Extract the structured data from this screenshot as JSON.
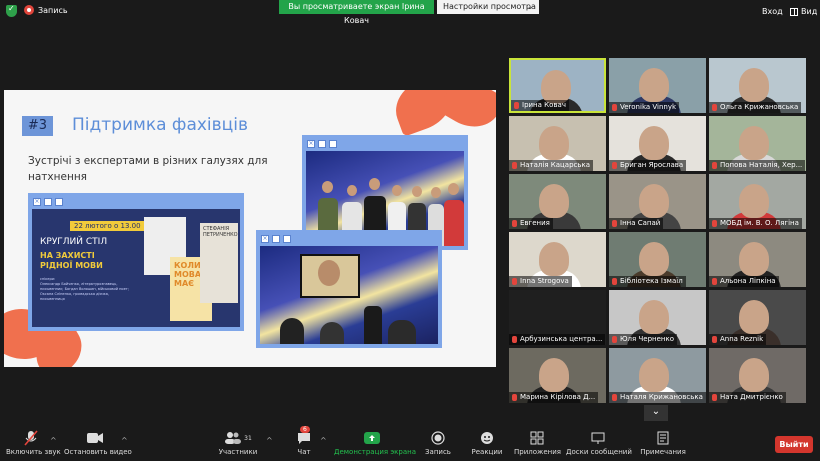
{
  "top": {
    "recording_label": "Запись",
    "share_banner": "Вы просматриваете экран Ірина Ковач",
    "view_options": "Настройки просмотра",
    "login": "Вход",
    "view": "Вид"
  },
  "slide": {
    "number": "#3",
    "title": "Підтримка фахівців",
    "subtitle": "Зустрічі з експертами в різних галузях для натхнення",
    "poster": {
      "date": "22 лютого о 13.00",
      "round_table": "КРУГЛИЙ СТІЛ",
      "headline": "НА ЗАХИСТІ РІДНОЇ МОВИ",
      "speakers_label": "спікери:",
      "speakers": "Олександр Бойченко, літературознавець, письменник; Богдан Волошин, військовий поет; Оксана Сліпенко, громадська діячка, письменниця",
      "book1": "КОЛИ МОВА МАЄ",
      "book2": "СТЕФАНІЯ ПЕТРИЧЕНКО"
    }
  },
  "participants": [
    {
      "name": "Ірина Ковач",
      "active": true
    },
    {
      "name": "Veronika Vinnyk"
    },
    {
      "name": "Ольга Крижановська"
    },
    {
      "name": "Наталія Кацарська"
    },
    {
      "name": "Бриган Ярослава"
    },
    {
      "name": "Попова Наталія, Хер..."
    },
    {
      "name": "Евгения"
    },
    {
      "name": "Інна Сапай"
    },
    {
      "name": "МОБД ім. В. О. Лягіна"
    },
    {
      "name": "Inna Strogova"
    },
    {
      "name": "Бібліотека Ізмаїл"
    },
    {
      "name": "Альона Ліпкіна"
    },
    {
      "name": "Арбузинська центра..."
    },
    {
      "name": "Юля Черненко"
    },
    {
      "name": "Anna Reznik"
    },
    {
      "name": "Марина Кірілова Д..."
    },
    {
      "name": "Наталя Крижановська"
    },
    {
      "name": "Ната Дмитрієнко"
    }
  ],
  "toolbar": {
    "mute": "Включить звук",
    "video": "Остановить видео",
    "participants": "Участники",
    "participants_count": "31",
    "chat": "Чат",
    "chat_badge": "6",
    "share": "Демонстрация экрана",
    "record": "Запись",
    "reactions": "Реакции",
    "apps": "Приложения",
    "whiteboards": "Доски сообщений",
    "notes": "Примечания",
    "leave": "Выйти"
  },
  "colors": {
    "share_green": "#23a44a",
    "active_speaker": "#c9e43a",
    "slide_blue": "#5d8ed8",
    "accent_orange": "#f0704e",
    "leave_red": "#d3362d"
  }
}
